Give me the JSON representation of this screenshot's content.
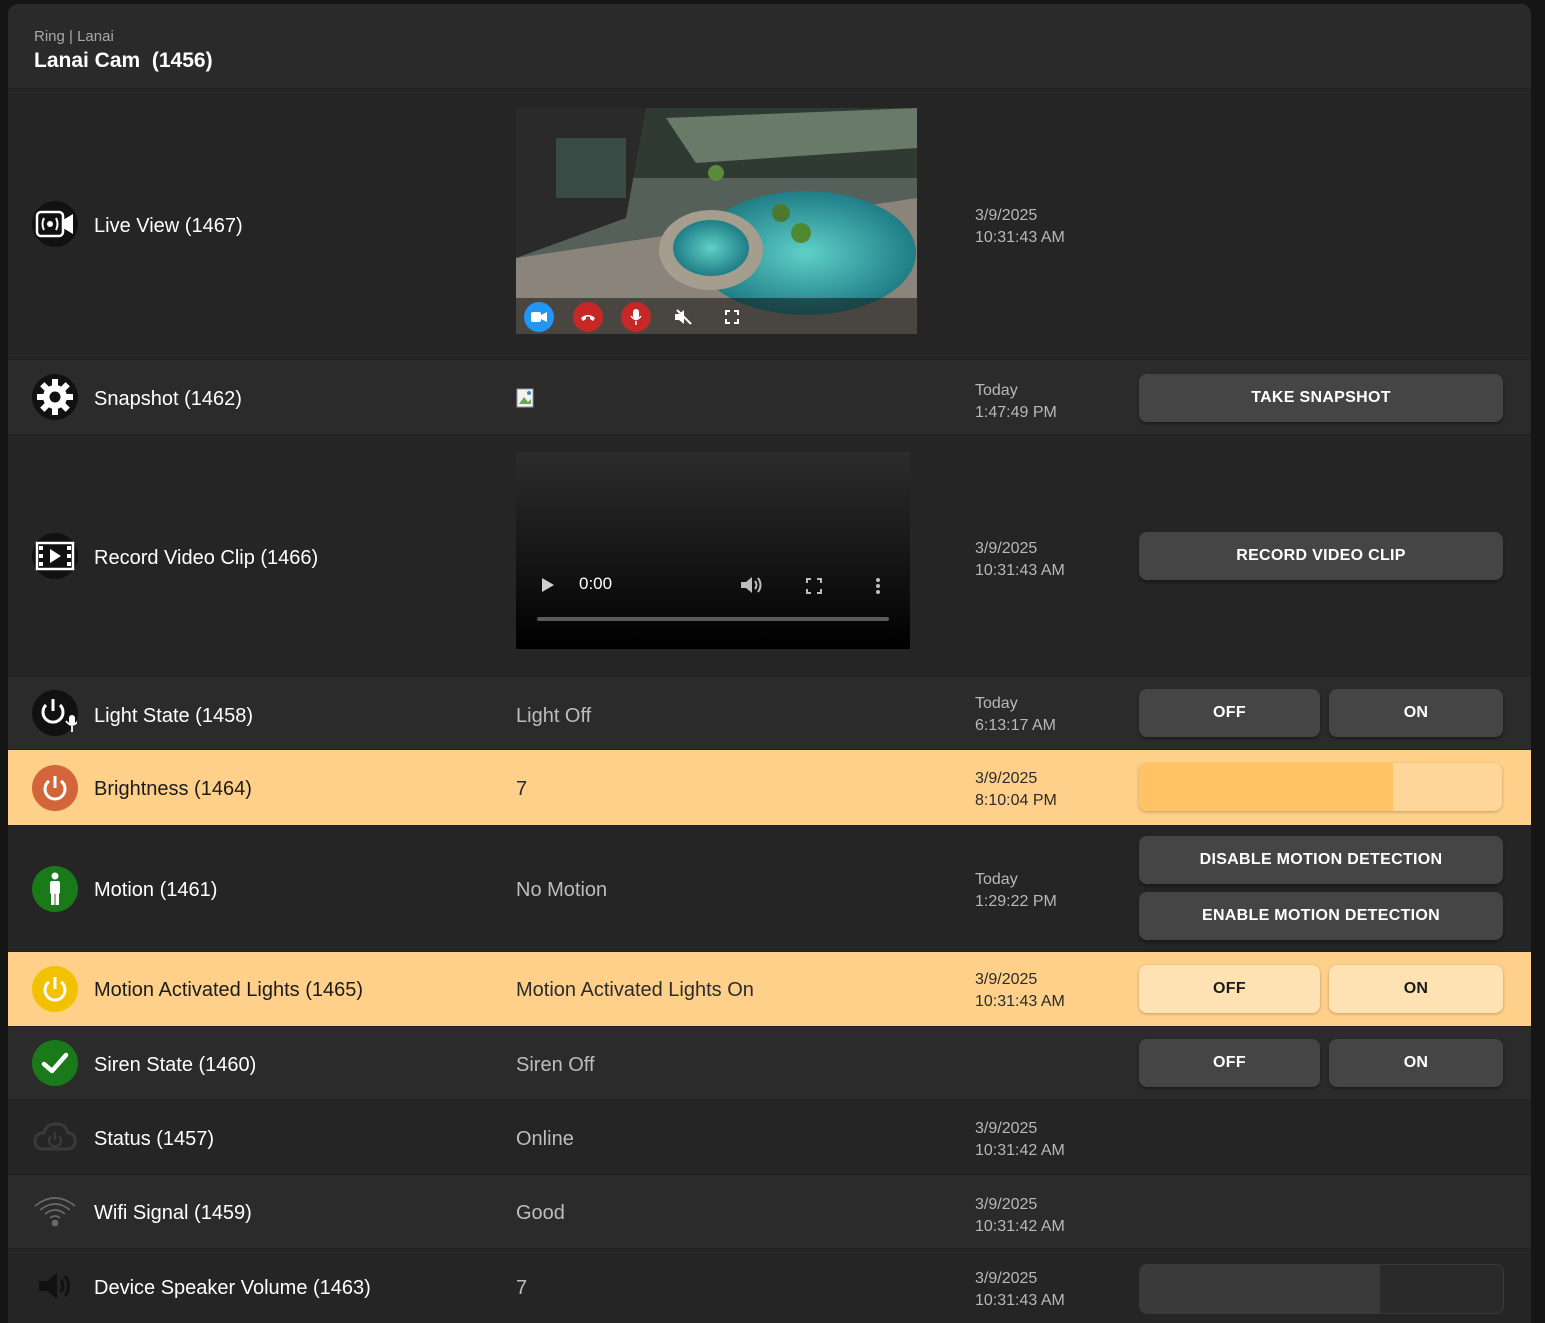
{
  "header": {
    "breadcrumb": "Ring | Lanai",
    "title": "Lanai Cam  (1456)"
  },
  "rows": [
    {
      "label": "Live View (1467)",
      "date": "3/9/2025",
      "time": "10:31:43 AM",
      "live_controls": [
        "video-icon",
        "hangup-icon",
        "mic-icon",
        "mute-icon",
        "fullscreen-icon"
      ]
    },
    {
      "label": "Snapshot (1462)",
      "date": "Today",
      "time": "1:47:49 PM",
      "button": "TAKE SNAPSHOT"
    },
    {
      "label": "Record Video Clip (1466)",
      "date": "3/9/2025",
      "time": "10:31:43 AM",
      "button": "RECORD VIDEO CLIP",
      "player_time": "0:00"
    },
    {
      "label": "Light State (1458)",
      "value": "Light Off",
      "date": "Today",
      "time": "6:13:17 AM",
      "off": "OFF",
      "on": "ON"
    },
    {
      "label": "Brightness (1464)",
      "value": "7",
      "date": "3/9/2025",
      "time": "8:10:04 PM",
      "level": 0.7
    },
    {
      "label": "Motion (1461)",
      "value": "No Motion",
      "date": "Today",
      "time": "1:29:22 PM",
      "button1": "DISABLE MOTION DETECTION",
      "button2": "ENABLE MOTION DETECTION"
    },
    {
      "label": "Motion Activated Lights (1465)",
      "value": "Motion Activated Lights On",
      "date": "3/9/2025",
      "time": "10:31:43 AM",
      "off": "OFF",
      "on": "ON"
    },
    {
      "label": "Siren State (1460)",
      "value": "Siren Off",
      "off": "OFF",
      "on": "ON"
    },
    {
      "label": "Status (1457)",
      "value": "Online",
      "date": "3/9/2025",
      "time": "10:31:42 AM"
    },
    {
      "label": "Wifi Signal (1459)",
      "value": "Good",
      "date": "3/9/2025",
      "time": "10:31:42 AM"
    },
    {
      "label": "Device Speaker Volume (1463)",
      "value": "7",
      "date": "3/9/2025",
      "time": "10:31:43 AM",
      "level": 0.66
    }
  ],
  "colors": {
    "highlight": "#ffd08a",
    "brightness_icon": "#d2653a",
    "motion_icon": "#1a7a1a",
    "lights_icon": "#f2c200",
    "siren_icon": "#1a7a1a",
    "live_video_btn": "#2196f3",
    "live_red_btn": "#c62828"
  }
}
